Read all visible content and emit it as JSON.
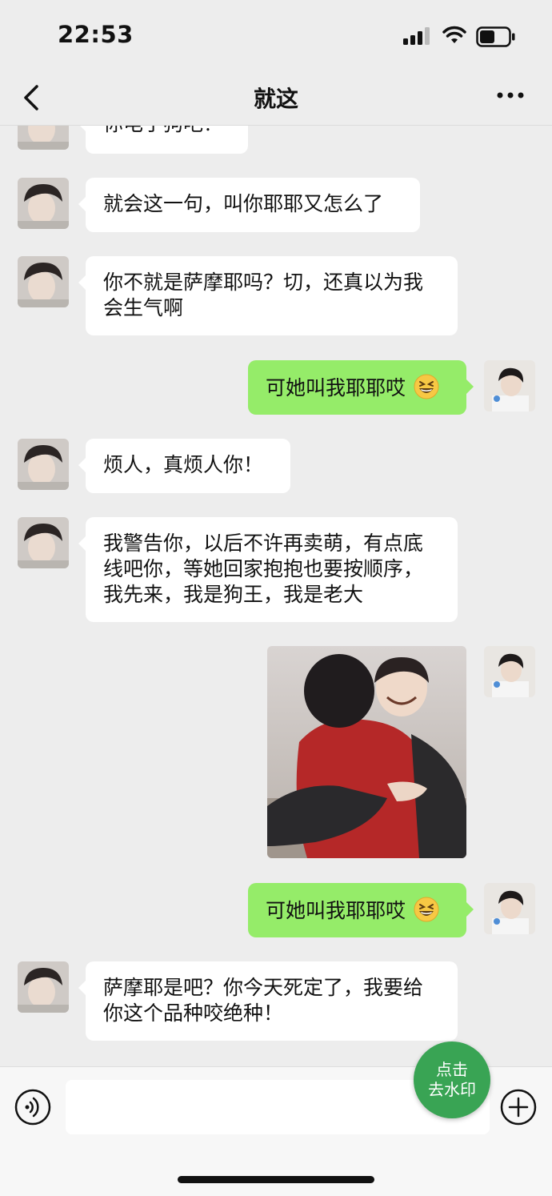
{
  "status_bar": {
    "time": "22:53"
  },
  "header": {
    "title": "就这"
  },
  "messages": [
    {
      "side": "left",
      "text": "你电子狗吧？"
    },
    {
      "side": "left",
      "text": "就会这一句，叫你耶耶又怎么了"
    },
    {
      "side": "left",
      "text": "你不就是萨摩耶吗？切，还真以为我会生气啊"
    },
    {
      "side": "right",
      "text": "可她叫我耶耶哎",
      "emoji": "grinning-squint-emoji"
    },
    {
      "side": "left",
      "text": "烦人，真烦人你！"
    },
    {
      "side": "left",
      "text": "我警告你，以后不许再卖萌，有点底线吧你，等她回家抱抱也要按顺序，我先来，我是狗王，我是老大"
    },
    {
      "side": "right",
      "type": "image",
      "image": "hug-photo"
    },
    {
      "side": "right",
      "text": "可她叫我耶耶哎",
      "emoji": "grinning-squint-emoji"
    },
    {
      "side": "left",
      "text": "萨摩耶是吧？你今天死定了，我要给你这个品种咬绝种！"
    }
  ],
  "watermark_button": {
    "line1": "点击",
    "line2": "去水印"
  },
  "colors": {
    "background": "#ededed",
    "sent_bubble": "#95ec69",
    "received_bubble": "#ffffff",
    "watermark_button": "#39a454"
  }
}
